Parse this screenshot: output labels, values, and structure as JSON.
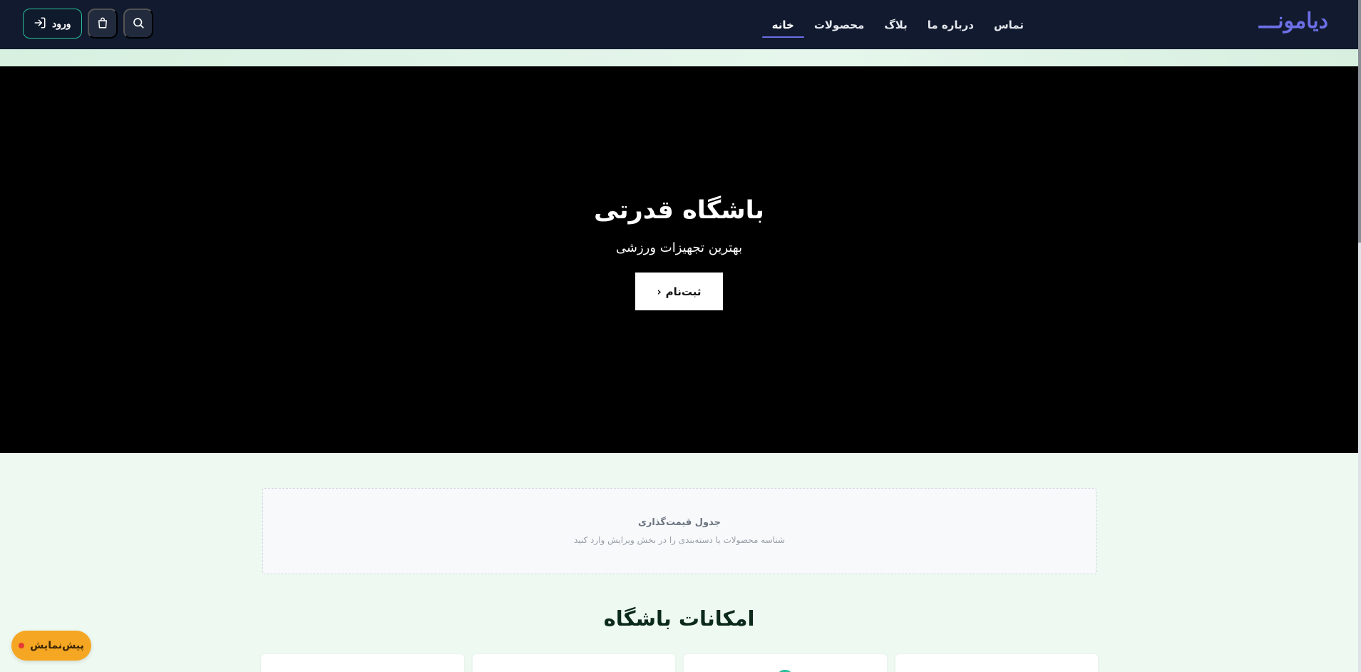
{
  "brand": {
    "logo_text": "دیامونـــ",
    "accent": "#6c6ee6"
  },
  "nav": {
    "items": [
      {
        "label": "خانه",
        "active": true
      },
      {
        "label": "محصولات",
        "active": false
      },
      {
        "label": "بلاگ",
        "active": false
      },
      {
        "label": "درباره ما",
        "active": false
      },
      {
        "label": "تماس",
        "active": false
      }
    ]
  },
  "header_tools": {
    "login_label": "ورود"
  },
  "hero": {
    "title": "باشگاه قدرتی",
    "subtitle": "بهترین تجهیزات ورزشی",
    "cta_label": "ثبت‌نام",
    "cta_arrow": "‹"
  },
  "pricing": {
    "title": "جدول قیمت‌گذاری",
    "description": "شناسه محصولات یا دسته‌بندی را در بخش ویرایش وارد کنید"
  },
  "features": {
    "title": "امکانات باشگاه"
  },
  "preview": {
    "label": "پیش‌نمایش"
  }
}
